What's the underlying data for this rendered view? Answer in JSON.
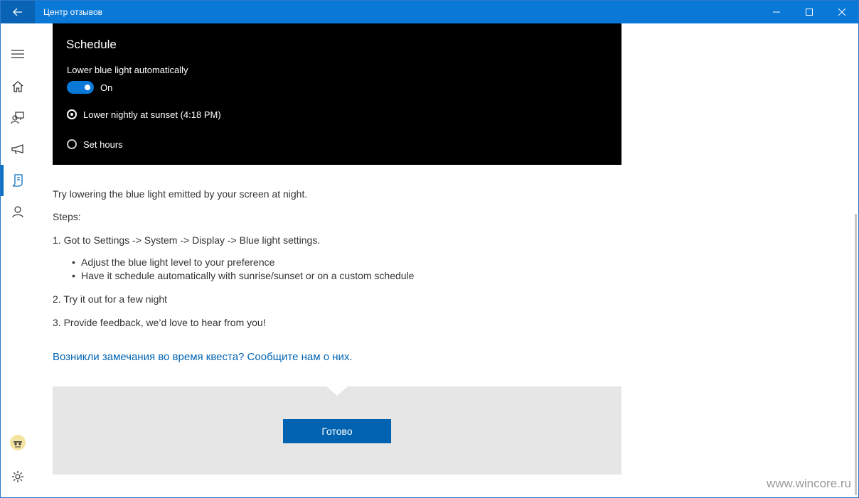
{
  "window": {
    "title": "Центр отзывов",
    "accent_color": "#0a78d7"
  },
  "titlebar_icons": {
    "back": "back-arrow-icon",
    "minimize": "minimize-icon",
    "maximize": "maximize-icon",
    "close": "close-icon"
  },
  "sidebar": {
    "items": [
      {
        "name": "hamburger-menu",
        "icon": "hamburger-icon"
      },
      {
        "name": "home",
        "icon": "home-icon"
      },
      {
        "name": "feedback",
        "icon": "feedback-icon"
      },
      {
        "name": "announcements",
        "icon": "megaphone-icon"
      },
      {
        "name": "quests",
        "icon": "quest-icon",
        "active": true
      },
      {
        "name": "profile",
        "icon": "person-icon"
      }
    ],
    "bottom": [
      {
        "name": "avatar",
        "icon": "avatar-icon"
      },
      {
        "name": "settings",
        "icon": "gear-icon"
      }
    ]
  },
  "screenshot_panel": {
    "title": "Schedule",
    "toggle_label": "Lower blue light automatically",
    "toggle_state": "On",
    "radio_options": [
      {
        "label": "Lower nightly at sunset (4:18 PM)",
        "checked": true
      },
      {
        "label": "Set hours",
        "checked": false
      }
    ]
  },
  "quest": {
    "intro": "Try lowering the blue light emitted by your screen at night.",
    "steps_heading": "Steps:",
    "step1": "1. Got to Settings -> System -> Display -> Blue light settings.",
    "bullets": [
      "Adjust the blue light level to your preference",
      "Have it schedule automatically with sunrise/sunset or on a custom schedule"
    ],
    "step2": "2. Try it out for a few night",
    "step3": "3. Provide feedback, we’d love to hear from you!",
    "feedback_link": "Возникли замечания во время квеста? Сообщите нам о них.",
    "done_button": "Готово"
  },
  "watermark": "www.wincore.ru"
}
